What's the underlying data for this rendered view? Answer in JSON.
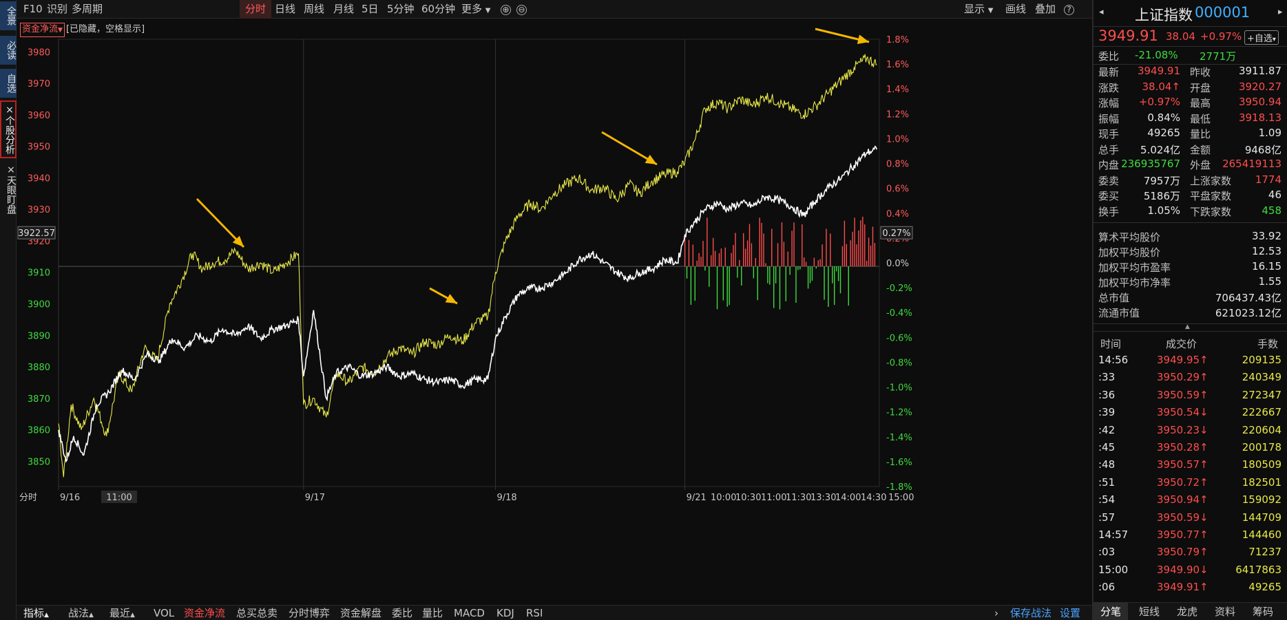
{
  "left_nav": [
    "全景",
    "必读",
    "自选",
    "×个股分析",
    "×天眼盯盘"
  ],
  "toolbar": {
    "items": [
      "F10",
      "识别",
      "多周期"
    ],
    "tabs": [
      "分时",
      "日线",
      "周线",
      "月线",
      "5日",
      "5分钟",
      "60分钟",
      "更多"
    ],
    "right": [
      "显示",
      "画线",
      "叠加"
    ],
    "plus_icon": "⊕",
    "minus_icon": "⊖",
    "help_icon": "?"
  },
  "legend": {
    "box": "资金净流",
    "note": "[已隐藏，空格显示]"
  },
  "chart_data": {
    "type": "line",
    "ylim": [
      3842,
      3984
    ],
    "pct_ylim": [
      -1.8,
      1.8
    ],
    "prev_close": 3911.87,
    "y_ticks": [
      3850,
      3860,
      3870,
      3880,
      3890,
      3900,
      3910,
      3920,
      3930,
      3940,
      3950,
      3960,
      3970,
      3980
    ],
    "pct_ticks": [
      "1.8%",
      "1.6%",
      "1.4%",
      "1.2%",
      "1.0%",
      "0.8%",
      "0.6%",
      "0.4%",
      "0.2%",
      "0.0%",
      "-0.2%",
      "-0.4%",
      "-0.6%",
      "-0.8%",
      "-1.0%",
      "-1.2%",
      "-1.4%",
      "-1.6%",
      "-1.8%"
    ],
    "hover_price": "3922.57",
    "hover_pct": "0.27%",
    "x_labels": [
      "9/16",
      "11:00",
      "9/17",
      "9/18",
      "9/21",
      "10:00",
      "10:30",
      "11:00",
      "11:30",
      "13:30",
      "14:00",
      "14:30",
      "15:00"
    ],
    "x_axis_title": "分时",
    "colors": {
      "price": "#e8e84a",
      "avg": "#ffffff",
      "inflow": "#ff4d4d",
      "outflow": "#3fdc3f",
      "arrow": "#f5b700"
    },
    "series": [
      {
        "values": [
          [
            0,
            3862
          ],
          [
            2,
            3845
          ],
          [
            5,
            3868
          ],
          [
            9,
            3860
          ],
          [
            14,
            3870
          ],
          [
            19,
            3858
          ],
          [
            24,
            3878
          ],
          [
            29,
            3872
          ],
          [
            34,
            3886
          ],
          [
            39,
            3882
          ],
          [
            44,
            3900
          ],
          [
            49,
            3908
          ],
          [
            53,
            3916
          ],
          [
            57,
            3911
          ],
          [
            61,
            3913
          ],
          [
            66,
            3914
          ],
          [
            70,
            3917
          ],
          [
            75,
            3911
          ],
          [
            80,
            3913
          ],
          [
            85,
            3910
          ],
          [
            90,
            3913
          ],
          [
            95,
            3916
          ],
          [
            97,
            3868
          ],
          [
            101,
            3870
          ],
          [
            106,
            3864
          ],
          [
            110,
            3878
          ],
          [
            115,
            3875
          ],
          [
            120,
            3880
          ],
          [
            125,
            3878
          ],
          [
            130,
            3883
          ],
          [
            135,
            3886
          ],
          [
            140,
            3884
          ],
          [
            145,
            3888
          ],
          [
            150,
            3887
          ],
          [
            155,
            3890
          ],
          [
            160,
            3888
          ],
          [
            165,
            3894
          ],
          [
            170,
            3896
          ],
          [
            173,
            3910
          ],
          [
            177,
            3920
          ],
          [
            182,
            3928
          ],
          [
            187,
            3932
          ],
          [
            191,
            3930
          ],
          [
            196,
            3935
          ],
          [
            201,
            3938
          ],
          [
            206,
            3940
          ],
          [
            211,
            3936
          ],
          [
            216,
            3937
          ],
          [
            221,
            3933
          ],
          [
            226,
            3938
          ],
          [
            230,
            3935
          ],
          [
            235,
            3939
          ],
          [
            240,
            3941
          ],
          [
            245,
            3942
          ],
          [
            248,
            3945
          ],
          [
            252,
            3952
          ],
          [
            256,
            3962
          ],
          [
            261,
            3964
          ],
          [
            265,
            3962
          ],
          [
            270,
            3965
          ],
          [
            275,
            3963
          ],
          [
            280,
            3966
          ],
          [
            285,
            3964
          ],
          [
            290,
            3962
          ],
          [
            295,
            3960
          ],
          [
            300,
            3963
          ],
          [
            305,
            3967
          ],
          [
            310,
            3971
          ],
          [
            315,
            3975
          ],
          [
            320,
            3978
          ],
          [
            324,
            3976
          ]
        ],
        "name": ""
      },
      {
        "values": [
          [
            0,
            3860
          ],
          [
            3,
            3850
          ],
          [
            6,
            3858
          ],
          [
            10,
            3852
          ],
          [
            15,
            3868
          ],
          [
            20,
            3872
          ],
          [
            25,
            3879
          ],
          [
            30,
            3876
          ],
          [
            35,
            3884
          ],
          [
            40,
            3882
          ],
          [
            45,
            3889
          ],
          [
            50,
            3886
          ],
          [
            55,
            3890
          ],
          [
            60,
            3888
          ],
          [
            65,
            3892
          ],
          [
            70,
            3890
          ],
          [
            75,
            3893
          ],
          [
            80,
            3889
          ],
          [
            85,
            3892
          ],
          [
            90,
            3893
          ],
          [
            95,
            3895
          ],
          [
            97,
            3877
          ],
          [
            101,
            3898
          ],
          [
            106,
            3870
          ],
          [
            110,
            3878
          ],
          [
            115,
            3880
          ],
          [
            120,
            3877
          ],
          [
            125,
            3878
          ],
          [
            130,
            3880
          ],
          [
            135,
            3877
          ],
          [
            140,
            3878
          ],
          [
            145,
            3876
          ],
          [
            150,
            3875
          ],
          [
            155,
            3876
          ],
          [
            160,
            3874
          ],
          [
            165,
            3876
          ],
          [
            170,
            3876
          ],
          [
            173,
            3889
          ],
          [
            177,
            3896
          ],
          [
            182,
            3903
          ],
          [
            187,
            3905
          ],
          [
            191,
            3905
          ],
          [
            196,
            3907
          ],
          [
            201,
            3910
          ],
          [
            206,
            3914
          ],
          [
            211,
            3916
          ],
          [
            216,
            3913
          ],
          [
            221,
            3910
          ],
          [
            226,
            3908
          ],
          [
            230,
            3910
          ],
          [
            235,
            3911
          ],
          [
            240,
            3914
          ],
          [
            245,
            3913
          ],
          [
            248,
            3922
          ],
          [
            252,
            3926
          ],
          [
            256,
            3930
          ],
          [
            261,
            3932
          ],
          [
            265,
            3930
          ],
          [
            270,
            3932
          ],
          [
            275,
            3931
          ],
          [
            280,
            3934
          ],
          [
            285,
            3933
          ],
          [
            290,
            3931
          ],
          [
            295,
            3928
          ],
          [
            300,
            3933
          ],
          [
            305,
            3937
          ],
          [
            310,
            3940
          ],
          [
            315,
            3944
          ],
          [
            320,
            3948
          ],
          [
            324,
            3949
          ]
        ],
        "name": ""
      }
    ]
  },
  "bottom": {
    "left_tabs": [
      "指标",
      "战法",
      "最近"
    ],
    "indicators": [
      "VOL",
      "资金净流",
      "总买总卖",
      "分时博弈",
      "资金解盘",
      "委比",
      "量比",
      "MACD",
      "KDJ",
      "RSI"
    ],
    "right": [
      "保存战法",
      "设置"
    ]
  },
  "quote": {
    "name": "上证指数",
    "code": "000001",
    "price": "3949.91",
    "change": "38.04",
    "pct": "+0.97%",
    "fav_button": "+自选",
    "webi_label": "委比",
    "webi_pct": "-21.08%",
    "webi_vol": "2771万",
    "rows": [
      [
        "最新",
        "3949.91",
        "昨收",
        "3911.87"
      ],
      [
        "涨跌",
        "38.04↑",
        "开盘",
        "3920.27"
      ],
      [
        "涨幅",
        "+0.97%",
        "最高",
        "3950.94"
      ],
      [
        "振幅",
        "0.84%",
        "最低",
        "3918.13"
      ],
      [
        "现手",
        "49265",
        "量比",
        "1.09"
      ],
      [
        "总手",
        "5.024亿",
        "金额",
        "9468亿"
      ],
      [
        "内盘",
        "236935767",
        "外盘",
        "265419113"
      ],
      [
        "委卖",
        "7957万",
        "上涨家数",
        "1774"
      ],
      [
        "委买",
        "5186万",
        "平盘家数",
        "46"
      ],
      [
        "换手",
        "1.05%",
        "下跌家数",
        "458"
      ]
    ],
    "extra": [
      [
        "算术平均股价",
        "33.92"
      ],
      [
        "加权平均股价",
        "12.53"
      ],
      [
        "加权平均市盈率",
        "16.15"
      ],
      [
        "加权平均市净率",
        "1.55"
      ],
      [
        "总市值",
        "706437.43亿"
      ],
      [
        "流通市值",
        "621023.12亿"
      ]
    ]
  },
  "ticks": {
    "headers": [
      "时间",
      "成交价",
      "手数"
    ],
    "rows": [
      [
        "14:56",
        "3949.95↑",
        "209135"
      ],
      [
        ":33",
        "3950.29↑",
        "240349"
      ],
      [
        ":36",
        "3950.59↑",
        "272347"
      ],
      [
        ":39",
        "3950.54↓",
        "222667"
      ],
      [
        ":42",
        "3950.23↓",
        "220604"
      ],
      [
        ":45",
        "3950.28↑",
        "200178"
      ],
      [
        ":48",
        "3950.57↑",
        "180509"
      ],
      [
        ":51",
        "3950.72↑",
        "182501"
      ],
      [
        ":54",
        "3950.94↑",
        "159092"
      ],
      [
        ":57",
        "3950.59↓",
        "144709"
      ],
      [
        "14:57",
        "3950.77↑",
        "144460"
      ],
      [
        ":03",
        "3950.79↑",
        "71237"
      ],
      [
        "15:00",
        "3949.90↓",
        "6417863"
      ],
      [
        ":06",
        "3949.91↑",
        "49265"
      ]
    ]
  },
  "right_tabs": [
    "分笔",
    "短线",
    "龙虎",
    "资料",
    "筹码"
  ]
}
